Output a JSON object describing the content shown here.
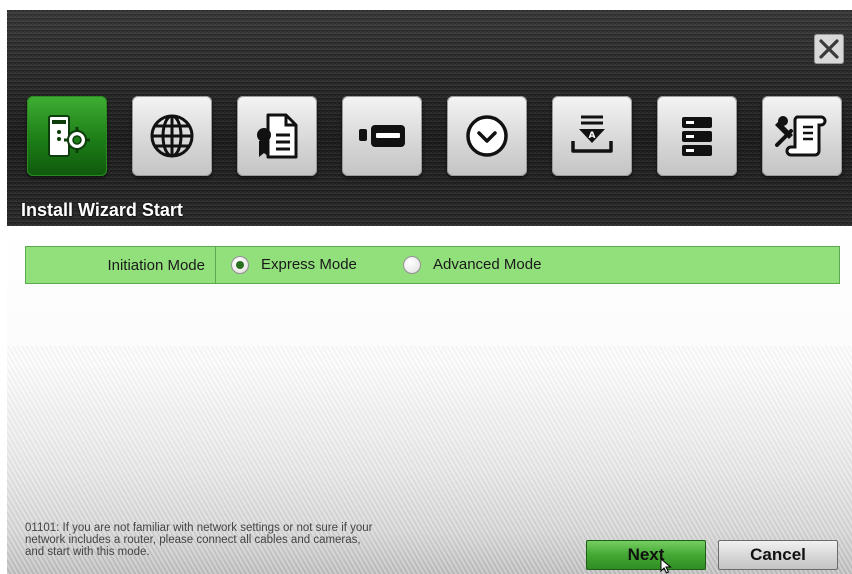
{
  "header": {
    "title": "Install Wizard Start",
    "close_icon": "close-icon",
    "toolbar_icons": [
      {
        "name": "system-settings-icon",
        "active": true
      },
      {
        "name": "network-globe-icon",
        "active": false
      },
      {
        "name": "certificate-document-icon",
        "active": false
      },
      {
        "name": "storage-drive-icon",
        "active": false
      },
      {
        "name": "clock-icon",
        "active": false
      },
      {
        "name": "download-tray-icon",
        "active": false
      },
      {
        "name": "server-stack-icon",
        "active": false
      },
      {
        "name": "tools-scroll-icon",
        "active": false
      }
    ]
  },
  "initiation": {
    "label": "Initiation Mode",
    "options": [
      {
        "label": "Express Mode",
        "selected": true
      },
      {
        "label": "Advanced Mode",
        "selected": false
      }
    ]
  },
  "hint": {
    "line1": "01101: If you are not familiar with network settings or not sure if your",
    "line2": "network includes a router, please connect all cables and cameras,",
    "line3": "and start with this mode."
  },
  "buttons": {
    "next": "Next",
    "cancel": "Cancel"
  },
  "colors": {
    "accent_green": "#92e07c",
    "active_icon_green": "#1d7d17"
  }
}
